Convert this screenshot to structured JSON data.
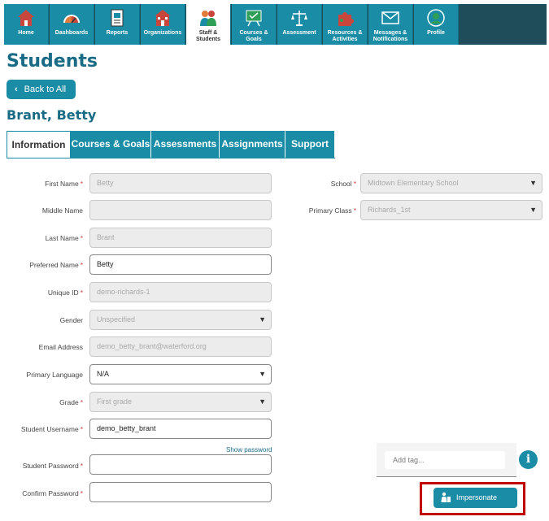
{
  "nav": {
    "items": [
      {
        "label": "Home",
        "icon": "home-icon"
      },
      {
        "label": "Dashboards",
        "icon": "gauge-icon"
      },
      {
        "label": "Reports",
        "icon": "report-icon"
      },
      {
        "label": "Organizations",
        "icon": "school-building-icon"
      },
      {
        "label": "Staff & Students",
        "icon": "people-icon"
      },
      {
        "label": "Courses & Goals",
        "icon": "goal-board-icon"
      },
      {
        "label": "Assessment",
        "icon": "scales-icon"
      },
      {
        "label": "Resources & Activities",
        "icon": "puzzle-icon"
      },
      {
        "label": "Messages & Notifications",
        "icon": "envelope-icon"
      },
      {
        "label": "Profile",
        "icon": "profile-icon"
      }
    ],
    "active_index": 4
  },
  "page": {
    "title": "Students",
    "back_label": "Back to All",
    "student_name": "Brant, Betty"
  },
  "tabs": [
    "Information",
    "Courses & Goals",
    "Assessments",
    "Assignments",
    "Support"
  ],
  "form": {
    "first_name": {
      "label": "First Name",
      "value": "Betty",
      "required": "*"
    },
    "middle_name": {
      "label": "Middle Name",
      "value": ""
    },
    "last_name": {
      "label": "Last Name",
      "value": "Brant",
      "required": "*"
    },
    "preferred_name": {
      "label": "Preferred Name",
      "value": "Betty",
      "required": "*"
    },
    "unique_id": {
      "label": "Unique ID",
      "value": "demo-richards-1",
      "required": "*"
    },
    "gender": {
      "label": "Gender",
      "value": "Unspecified"
    },
    "email": {
      "label": "Email Address",
      "value": "demo_betty_brant@waterford.org"
    },
    "primary_language": {
      "label": "Primary Language",
      "value": "N/A"
    },
    "grade": {
      "label": "Grade",
      "value": "First grade",
      "required": "*"
    },
    "username": {
      "label": "Student Username",
      "value": "demo_betty_brant",
      "required": "*"
    },
    "show_password": "Show password",
    "password": {
      "label": "Student Password",
      "value": "",
      "required": "*"
    },
    "confirm_password": {
      "label": "Confirm Password",
      "value": "",
      "required": "*"
    },
    "school": {
      "label": "School",
      "value": "Midtown Elementary School",
      "required": "*"
    },
    "primary_class": {
      "label": "Primary Class",
      "value": "Richards_1st",
      "required": "*"
    }
  },
  "tags": {
    "placeholder": "Add tag..."
  },
  "info_glyph": "i",
  "impersonate_label": "Impersonate",
  "colors": {
    "nav": "#1a8ca5",
    "title": "#1a6b86",
    "highlight": "#c00000"
  }
}
